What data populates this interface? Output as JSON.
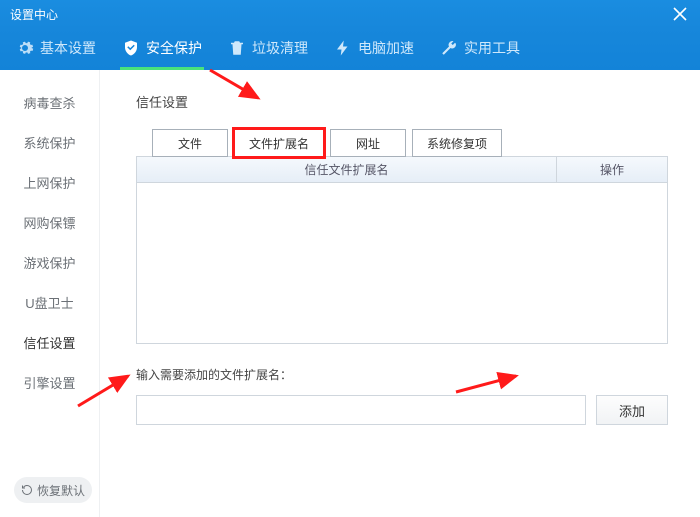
{
  "titlebar": {
    "title": "设置中心"
  },
  "tabs": [
    {
      "label": "基本设置",
      "icon": "gear"
    },
    {
      "label": "安全保护",
      "icon": "shield",
      "active": true
    },
    {
      "label": "垃圾清理",
      "icon": "trash"
    },
    {
      "label": "电脑加速",
      "icon": "bolt"
    },
    {
      "label": "实用工具",
      "icon": "wrench"
    }
  ],
  "sidebar": {
    "items": [
      "病毒查杀",
      "系统保护",
      "上网保护",
      "网购保镖",
      "游戏保护",
      "U盘卫士",
      "信任设置",
      "引擎设置"
    ],
    "active_index": 6,
    "restore_label": "恢复默认"
  },
  "main": {
    "section_title": "信任设置",
    "subtabs": [
      {
        "label": "文件"
      },
      {
        "label": "文件扩展名",
        "highlight": true
      },
      {
        "label": "网址"
      },
      {
        "label": "系统修复项"
      }
    ],
    "table": {
      "col1": "信任文件扩展名",
      "col2": "操作",
      "rows": []
    },
    "prompt": "输入需要添加的文件扩展名：",
    "input_value": "",
    "input_placeholder": "",
    "add_button": "添加"
  },
  "colors": {
    "accent_blue": "#1787db",
    "active_underline": "#49e27b",
    "highlight_red": "#ff1a1a"
  }
}
